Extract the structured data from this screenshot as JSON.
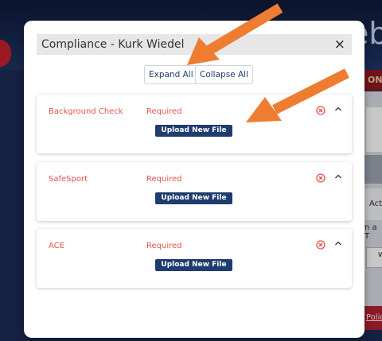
{
  "modal": {
    "title": "Compliance - Kurk Wiedel",
    "close_glyph": "×",
    "expand_all_label": "Expand All",
    "collapse_all_label": "Collapse All"
  },
  "compliance_items": [
    {
      "name": "Background Check",
      "status": "Required",
      "upload_label": "Upload New File"
    },
    {
      "name": "SafeSport",
      "status": "Required",
      "upload_label": "Upload New File"
    },
    {
      "name": "ACE",
      "status": "Required",
      "upload_label": "Upload New File"
    }
  ],
  "background": {
    "header_fragment": "eb",
    "red_band_fragment": "ON",
    "column_fragment": "Acti",
    "text_fragment": "n a T",
    "select_chevron": "∨",
    "link_fragment": "Policy"
  },
  "colors": {
    "status_red": "#e0534f",
    "button_navy": "#1f3c6e",
    "annotation_orange": "#ef7d31"
  },
  "icons": {
    "remove": "circled-x-icon",
    "collapse": "chevron-up-icon"
  }
}
